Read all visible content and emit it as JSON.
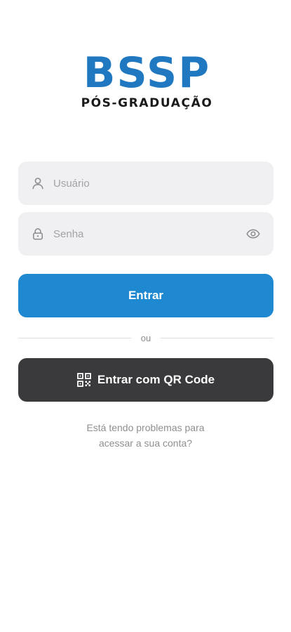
{
  "brand": {
    "title": "BSSP",
    "subtitle": "PÓS-GRADUAÇÃO",
    "color": "#1f78c0"
  },
  "form": {
    "username": {
      "placeholder": "Usuário",
      "value": "",
      "icon": "user-icon"
    },
    "password": {
      "placeholder": "Senha",
      "value": "",
      "icon": "lock-icon",
      "toggle_icon": "eye-icon"
    },
    "submit_label": "Entrar",
    "submit_color": "#1e88d0"
  },
  "divider_label": "ou",
  "qr_button": {
    "label": "Entrar com QR Code",
    "icon": "qr-code-icon",
    "color": "#3a3a3c"
  },
  "help": {
    "line1": "Está tendo problemas para",
    "line2": "acessar a sua conta?"
  }
}
